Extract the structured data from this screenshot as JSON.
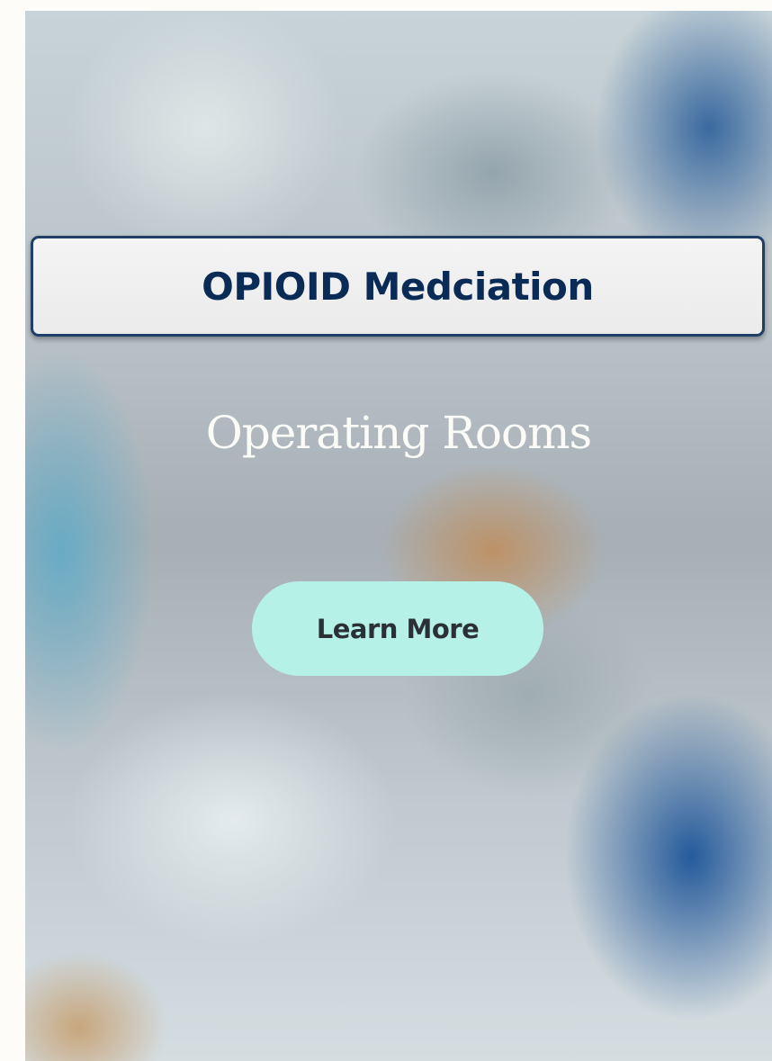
{
  "hero": {
    "title": "OPIOID Medciation",
    "subtitle": "Operating Rooms",
    "cta_label": "Learn More"
  },
  "colors": {
    "title_text": "#0b2b57",
    "title_border": "#1f3f66",
    "title_background": "#ededed",
    "subtitle_text": "#fbfbf8",
    "button_background": "#b6f1e8",
    "button_text": "#2a3033",
    "page_background": "#fdfcf8"
  }
}
